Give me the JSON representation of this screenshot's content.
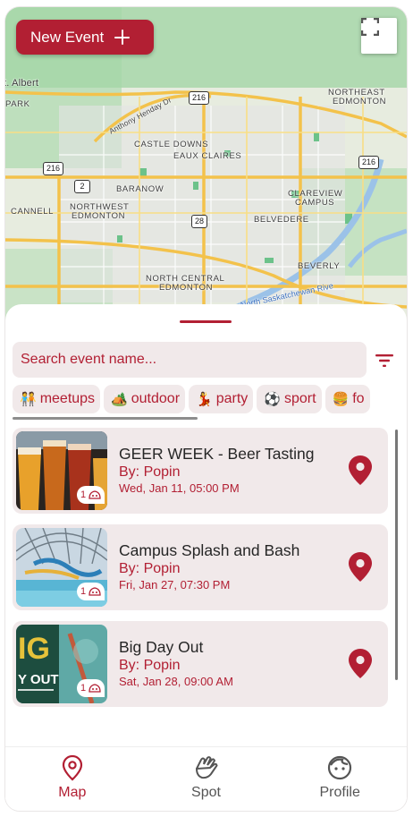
{
  "map": {
    "new_event_label": "New Event",
    "labels": {
      "st_albert": "t. Albert",
      "park": "PARK",
      "northeast_edmonton_1": "NORTHEAST",
      "northeast_edmonton_2": "EDMONTON",
      "castle_downs": "CASTLE DOWNS",
      "eaux_claires": "EAUX CLAIRES",
      "baranow": "BARANOW",
      "clareview_1": "CLAREVIEW",
      "clareview_2": "CAMPUS",
      "cannell": "CANNELL",
      "northwest_1": "NORTHWEST",
      "northwest_2": "EDMONTON",
      "belvedere": "BELVEDERE",
      "beverly": "BEVERLY",
      "north_central_1": "NORTH CENTRAL",
      "north_central_2": "EDMONTON",
      "anthony_henday": "Anthony Henday Dr",
      "north_sask": "North Saskatchewan Rive"
    },
    "shields": [
      "216",
      "216",
      "216",
      "2",
      "28"
    ]
  },
  "search": {
    "placeholder": "Search event name..."
  },
  "chips": [
    {
      "emoji": "🧑‍🤝‍🧑",
      "label": "meetups"
    },
    {
      "emoji": "🏕️",
      "label": "outdoor"
    },
    {
      "emoji": "💃",
      "label": "party"
    },
    {
      "emoji": "⚽",
      "label": "sport"
    },
    {
      "emoji": "🍔",
      "label": "fo"
    }
  ],
  "events": [
    {
      "title": "GEER WEEK - Beer Tasting",
      "by": "By: Popin",
      "date": "Wed, Jan 11, 05:00 PM",
      "attendees": "1"
    },
    {
      "title": "Campus Splash and Bash",
      "by": "By: Popin",
      "date": "Fri, Jan 27, 07:30 PM",
      "attendees": "1"
    },
    {
      "title": "Big Day Out",
      "by": "By: Popin",
      "date": "Sat, Jan 28, 09:00 AM",
      "attendees": "1",
      "thumb_text_1": "IG",
      "thumb_text_2": "Y OUT"
    }
  ],
  "nav": {
    "map": "Map",
    "spot": "Spot",
    "profile": "Profile"
  },
  "colors": {
    "accent": "#b21f33",
    "chip_bg": "#f1e9ea",
    "inactive_nav": "#555555"
  },
  "icons": {
    "plus": "plus-icon",
    "fullscreen": "fullscreen-icon",
    "filter": "filter-icon",
    "pin": "map-pin-icon",
    "attendee": "attendee-icon",
    "map_nav": "map-pin-icon",
    "spot_nav": "hands-icon",
    "profile_nav": "face-icon"
  }
}
